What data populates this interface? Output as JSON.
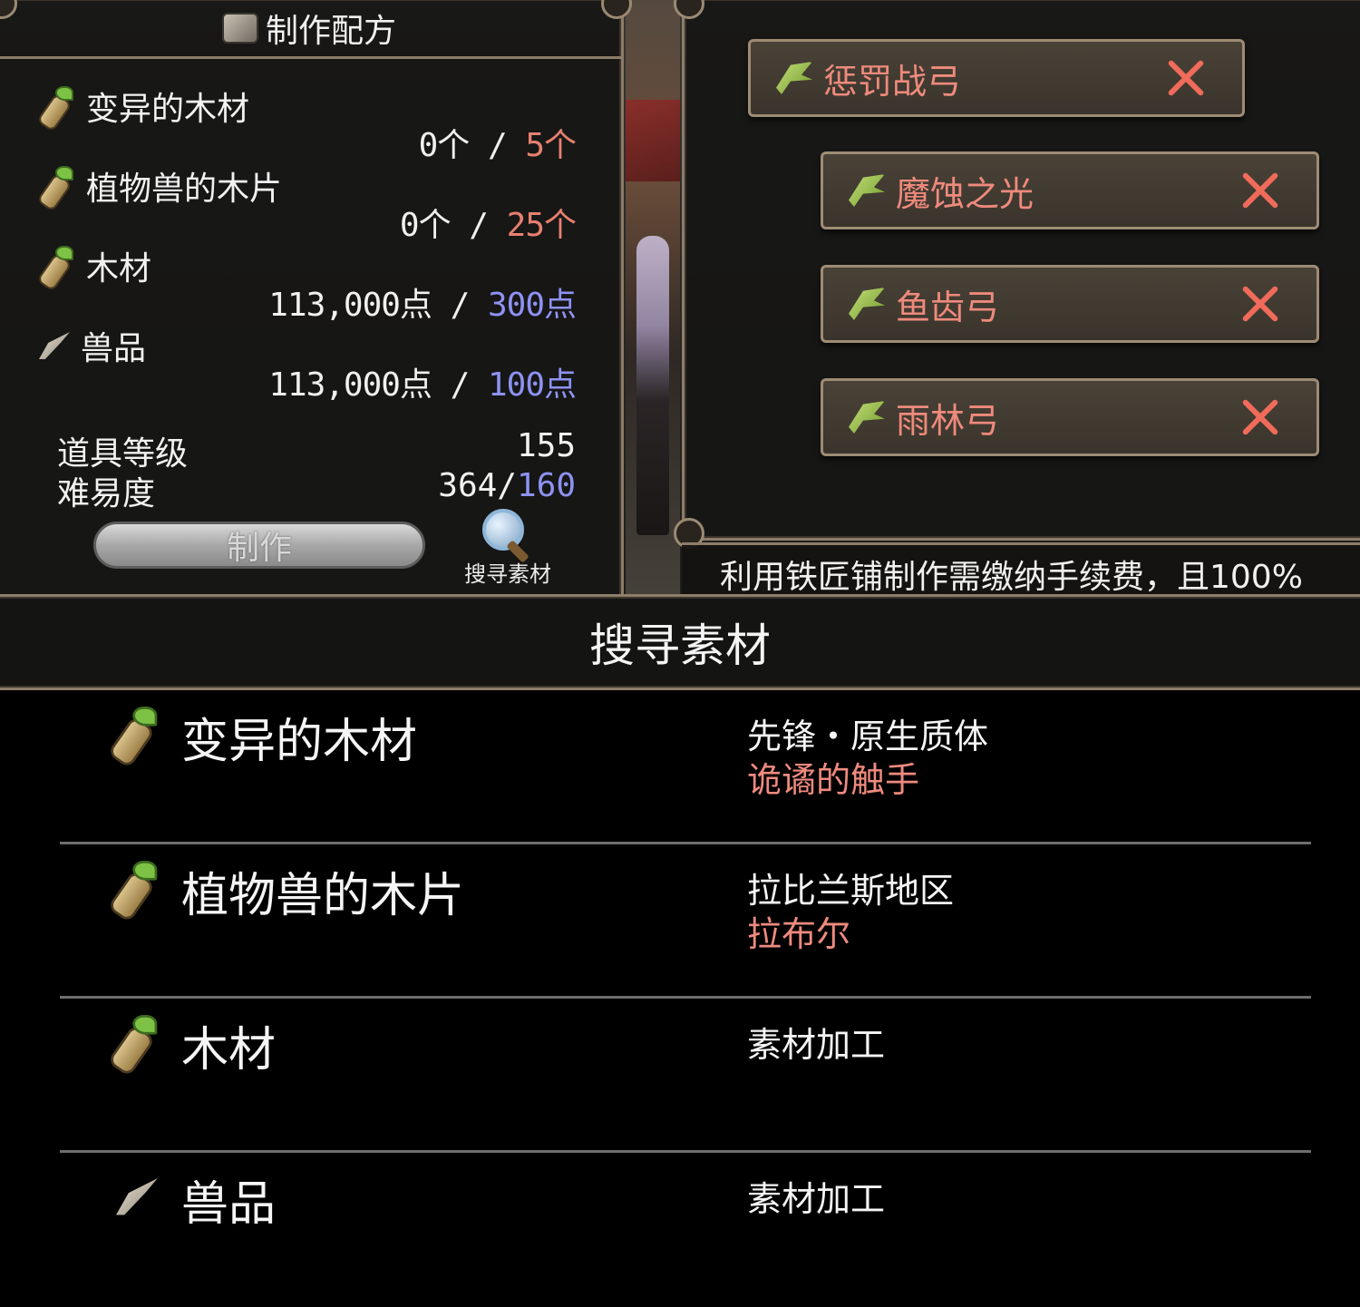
{
  "recipe": {
    "title": "制作配方",
    "materials": [
      {
        "icon": "wood-icon",
        "name": "变异的木材",
        "have": "0个",
        "sep": " / ",
        "need": "5个",
        "need_color": "#e7806f"
      },
      {
        "icon": "wood-icon",
        "name": "植物兽的木片",
        "have": "0个",
        "sep": " / ",
        "need": "25个",
        "need_color": "#e7806f"
      },
      {
        "icon": "wood-icon",
        "name": "木材",
        "have": "113,000点",
        "sep": " / ",
        "need": "300点",
        "need_color": "#8d92f2"
      },
      {
        "icon": "fang-icon",
        "name": "兽品",
        "have": "113,000点",
        "sep": " / ",
        "need": "100点",
        "need_color": "#8d92f2"
      }
    ],
    "item_level_label": "道具等级",
    "item_level_value": "155",
    "difficulty_label": "难易度",
    "difficulty_have": "364/",
    "difficulty_need": "160",
    "make_button": "制作",
    "search_button": "搜寻素材"
  },
  "products": [
    {
      "icon": "bow-icon",
      "name": "惩罚战弓"
    },
    {
      "icon": "bow-icon",
      "name": "魔蚀之光"
    },
    {
      "icon": "bow-icon",
      "name": "鱼齿弓"
    },
    {
      "icon": "bow-icon",
      "name": "雨林弓"
    }
  ],
  "notice": "利用铁匠铺制作需缴纳手续费，且100%",
  "search_panel": {
    "title": "搜寻素材",
    "rows": [
      {
        "icon": "wood-icon",
        "name": "变异的木材",
        "source1": "先锋・原生质体",
        "source2": "诡谲的触手"
      },
      {
        "icon": "wood-icon",
        "name": "植物兽的木片",
        "source1": "拉比兰斯地区",
        "source2": "拉布尔"
      },
      {
        "icon": "wood-icon",
        "name": "木材",
        "source1": "素材加工",
        "source2": ""
      },
      {
        "icon": "fang-icon",
        "name": "兽品",
        "source1": "素材加工",
        "source2": ""
      }
    ]
  }
}
